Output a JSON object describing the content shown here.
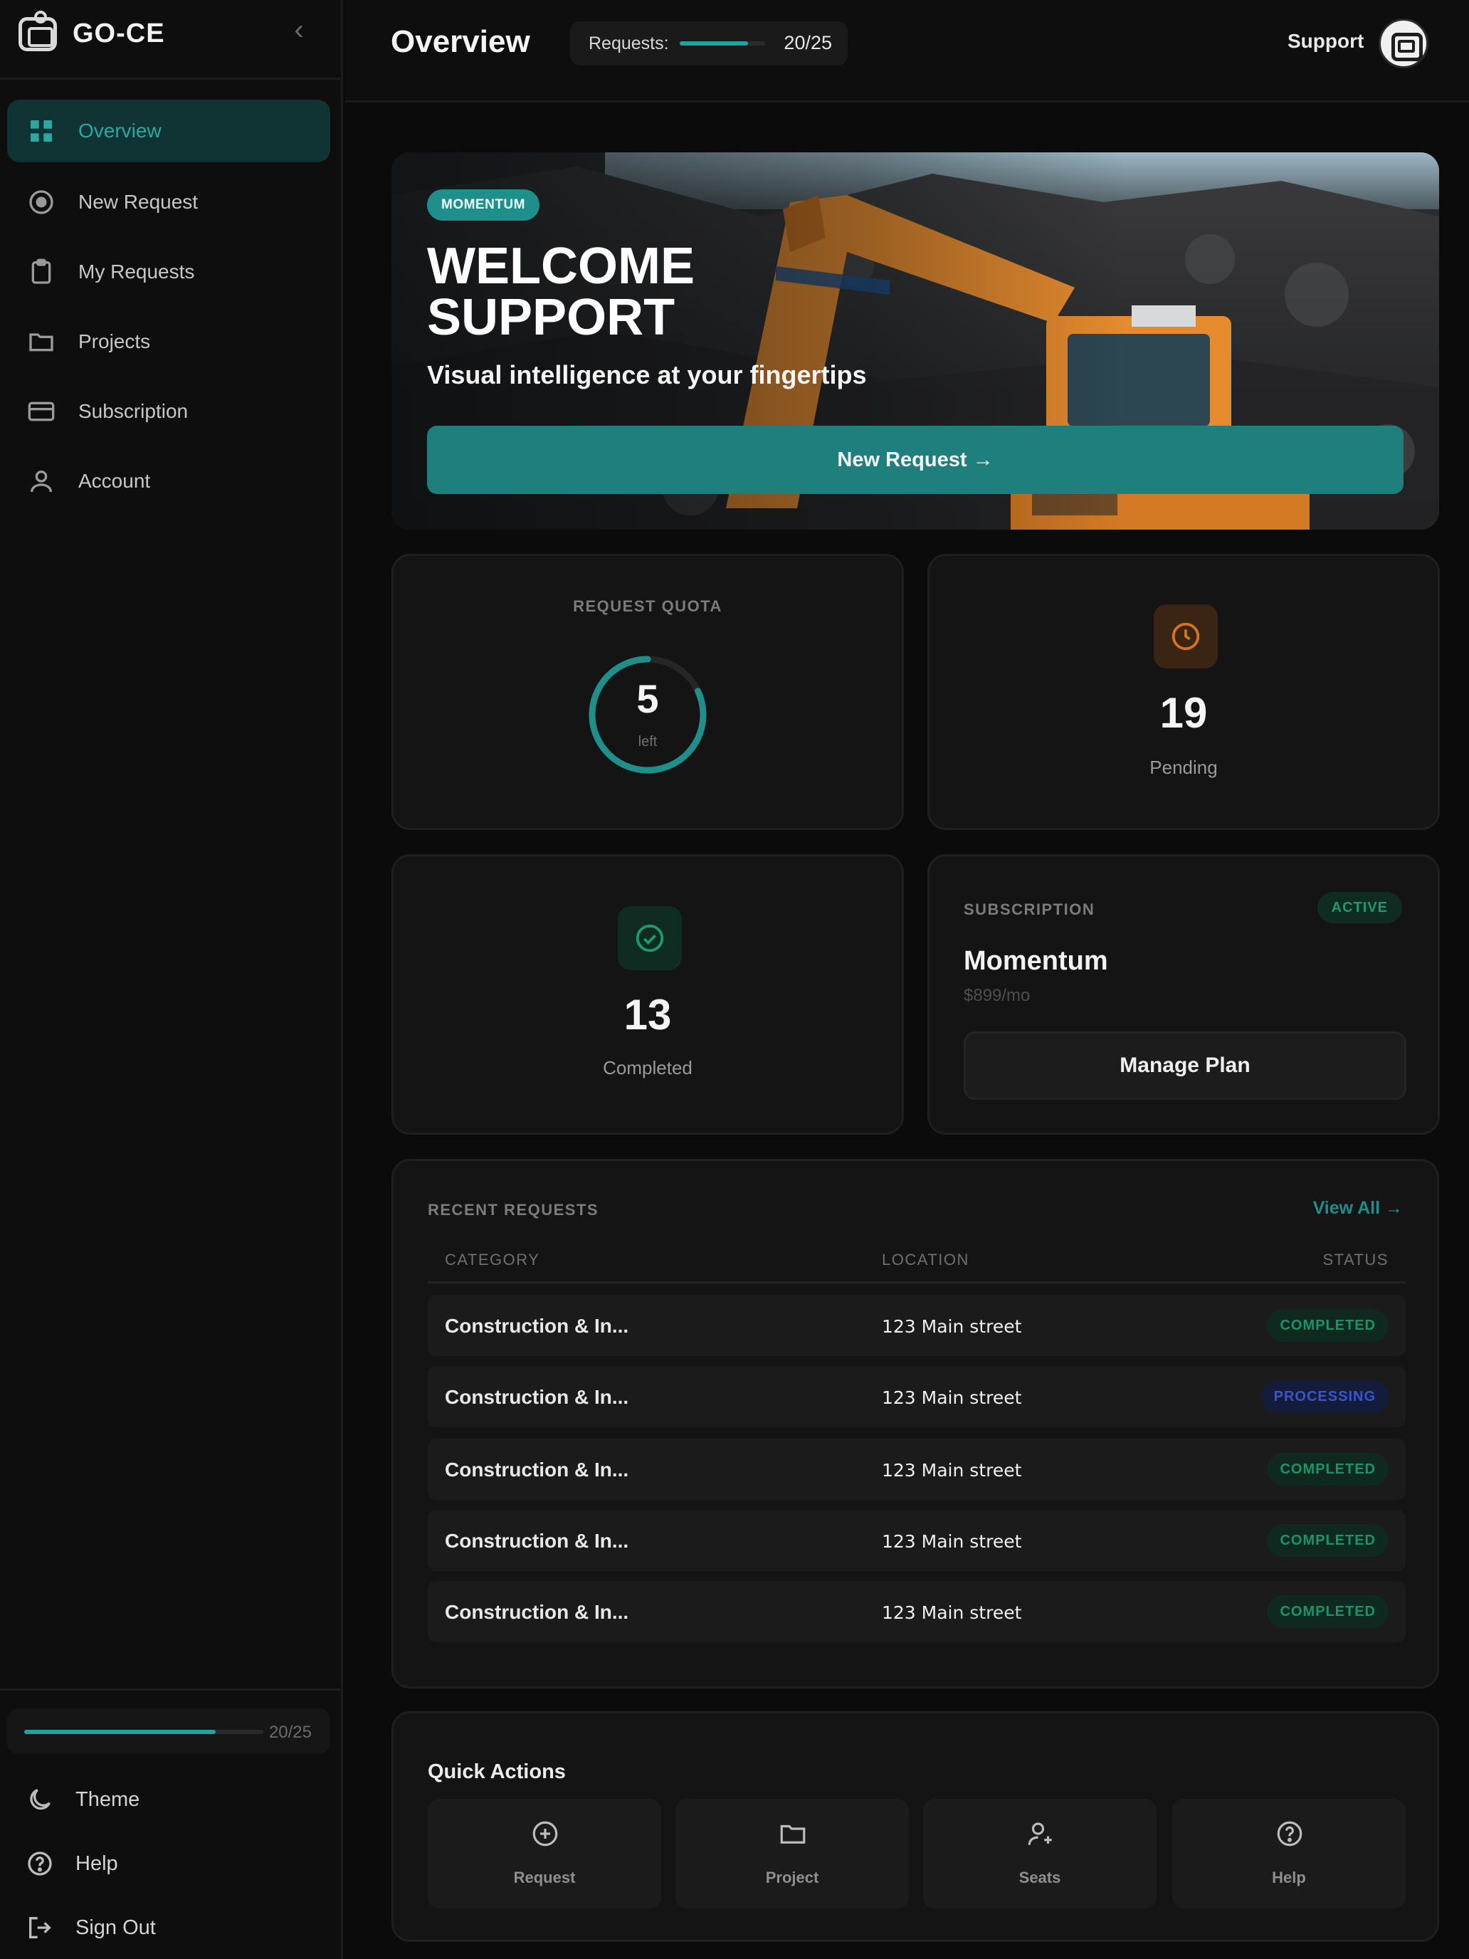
{
  "app": {
    "name": "GO-CE",
    "collapse_glyph": "‹"
  },
  "sidebar": {
    "items": [
      {
        "label": "Overview",
        "icon": "grid-icon",
        "active": true
      },
      {
        "label": "New Request",
        "icon": "plus-circle-icon"
      },
      {
        "label": "My Requests",
        "icon": "clipboard-icon"
      },
      {
        "label": "Projects",
        "icon": "folder-icon"
      },
      {
        "label": "Subscription",
        "icon": "credit-card-icon"
      },
      {
        "label": "Account",
        "icon": "user-icon"
      }
    ],
    "quota": {
      "text": "20/25",
      "used": 20,
      "total": 25
    },
    "bottom": [
      {
        "label": "Theme",
        "icon": "moon-icon"
      },
      {
        "label": "Help",
        "icon": "help-circle-icon"
      },
      {
        "label": "Sign Out",
        "icon": "sign-out-icon"
      }
    ]
  },
  "header": {
    "title": "Overview",
    "requests_label": "Requests:",
    "requests_count": "20/25",
    "requests_fraction": 0.8,
    "support_label": "Support"
  },
  "hero": {
    "badge": "MOMENTUM",
    "title_line1": "WELCOME",
    "title_line2": "SUPPORT",
    "subtitle": "Visual intelligence at your fingertips",
    "cta": "New Request →"
  },
  "quota_card": {
    "caption": "REQUEST QUOTA",
    "remaining": "5",
    "remaining_label": "left",
    "remaining_fraction": 0.2
  },
  "pending_card": {
    "value": "19",
    "label": "Pending",
    "icon": "clock-icon"
  },
  "completed_card": {
    "value": "13",
    "label": "Completed",
    "icon": "check-circle-icon"
  },
  "subscription_card": {
    "caption": "SUBSCRIPTION",
    "status": "ACTIVE",
    "plan": "Momentum",
    "price": "$899/mo",
    "button": "Manage Plan"
  },
  "recent_requests": {
    "title": "RECENT REQUESTS",
    "view_all": "View All →",
    "columns": [
      "CATEGORY",
      "LOCATION",
      "STATUS"
    ],
    "rows": [
      {
        "category": "Construction & In...",
        "location": "123 Main street",
        "status": "COMPLETED"
      },
      {
        "category": "Construction & In...",
        "location": "123 Main street",
        "status": "PROCESSING"
      },
      {
        "category": "Construction & In...",
        "location": "123 Main street",
        "status": "COMPLETED"
      },
      {
        "category": "Construction & In...",
        "location": "123 Main street",
        "status": "COMPLETED"
      },
      {
        "category": "Construction & In...",
        "location": "123 Main street",
        "status": "COMPLETED"
      }
    ]
  },
  "quick_actions": {
    "title": "Quick Actions",
    "items": [
      {
        "label": "Request",
        "icon": "plus-circle-icon"
      },
      {
        "label": "Project",
        "icon": "folder-icon"
      },
      {
        "label": "Seats",
        "icon": "user-plus-icon"
      },
      {
        "label": "Help",
        "icon": "help-circle-icon"
      }
    ]
  },
  "colors": {
    "accent": "#23a39f",
    "accent_dark": "#1e7f7d",
    "background": "#0b0b0b",
    "card": "#141414",
    "pending": "#d6731f",
    "completed": "#1a9d6c",
    "processing": "#3955c8"
  }
}
